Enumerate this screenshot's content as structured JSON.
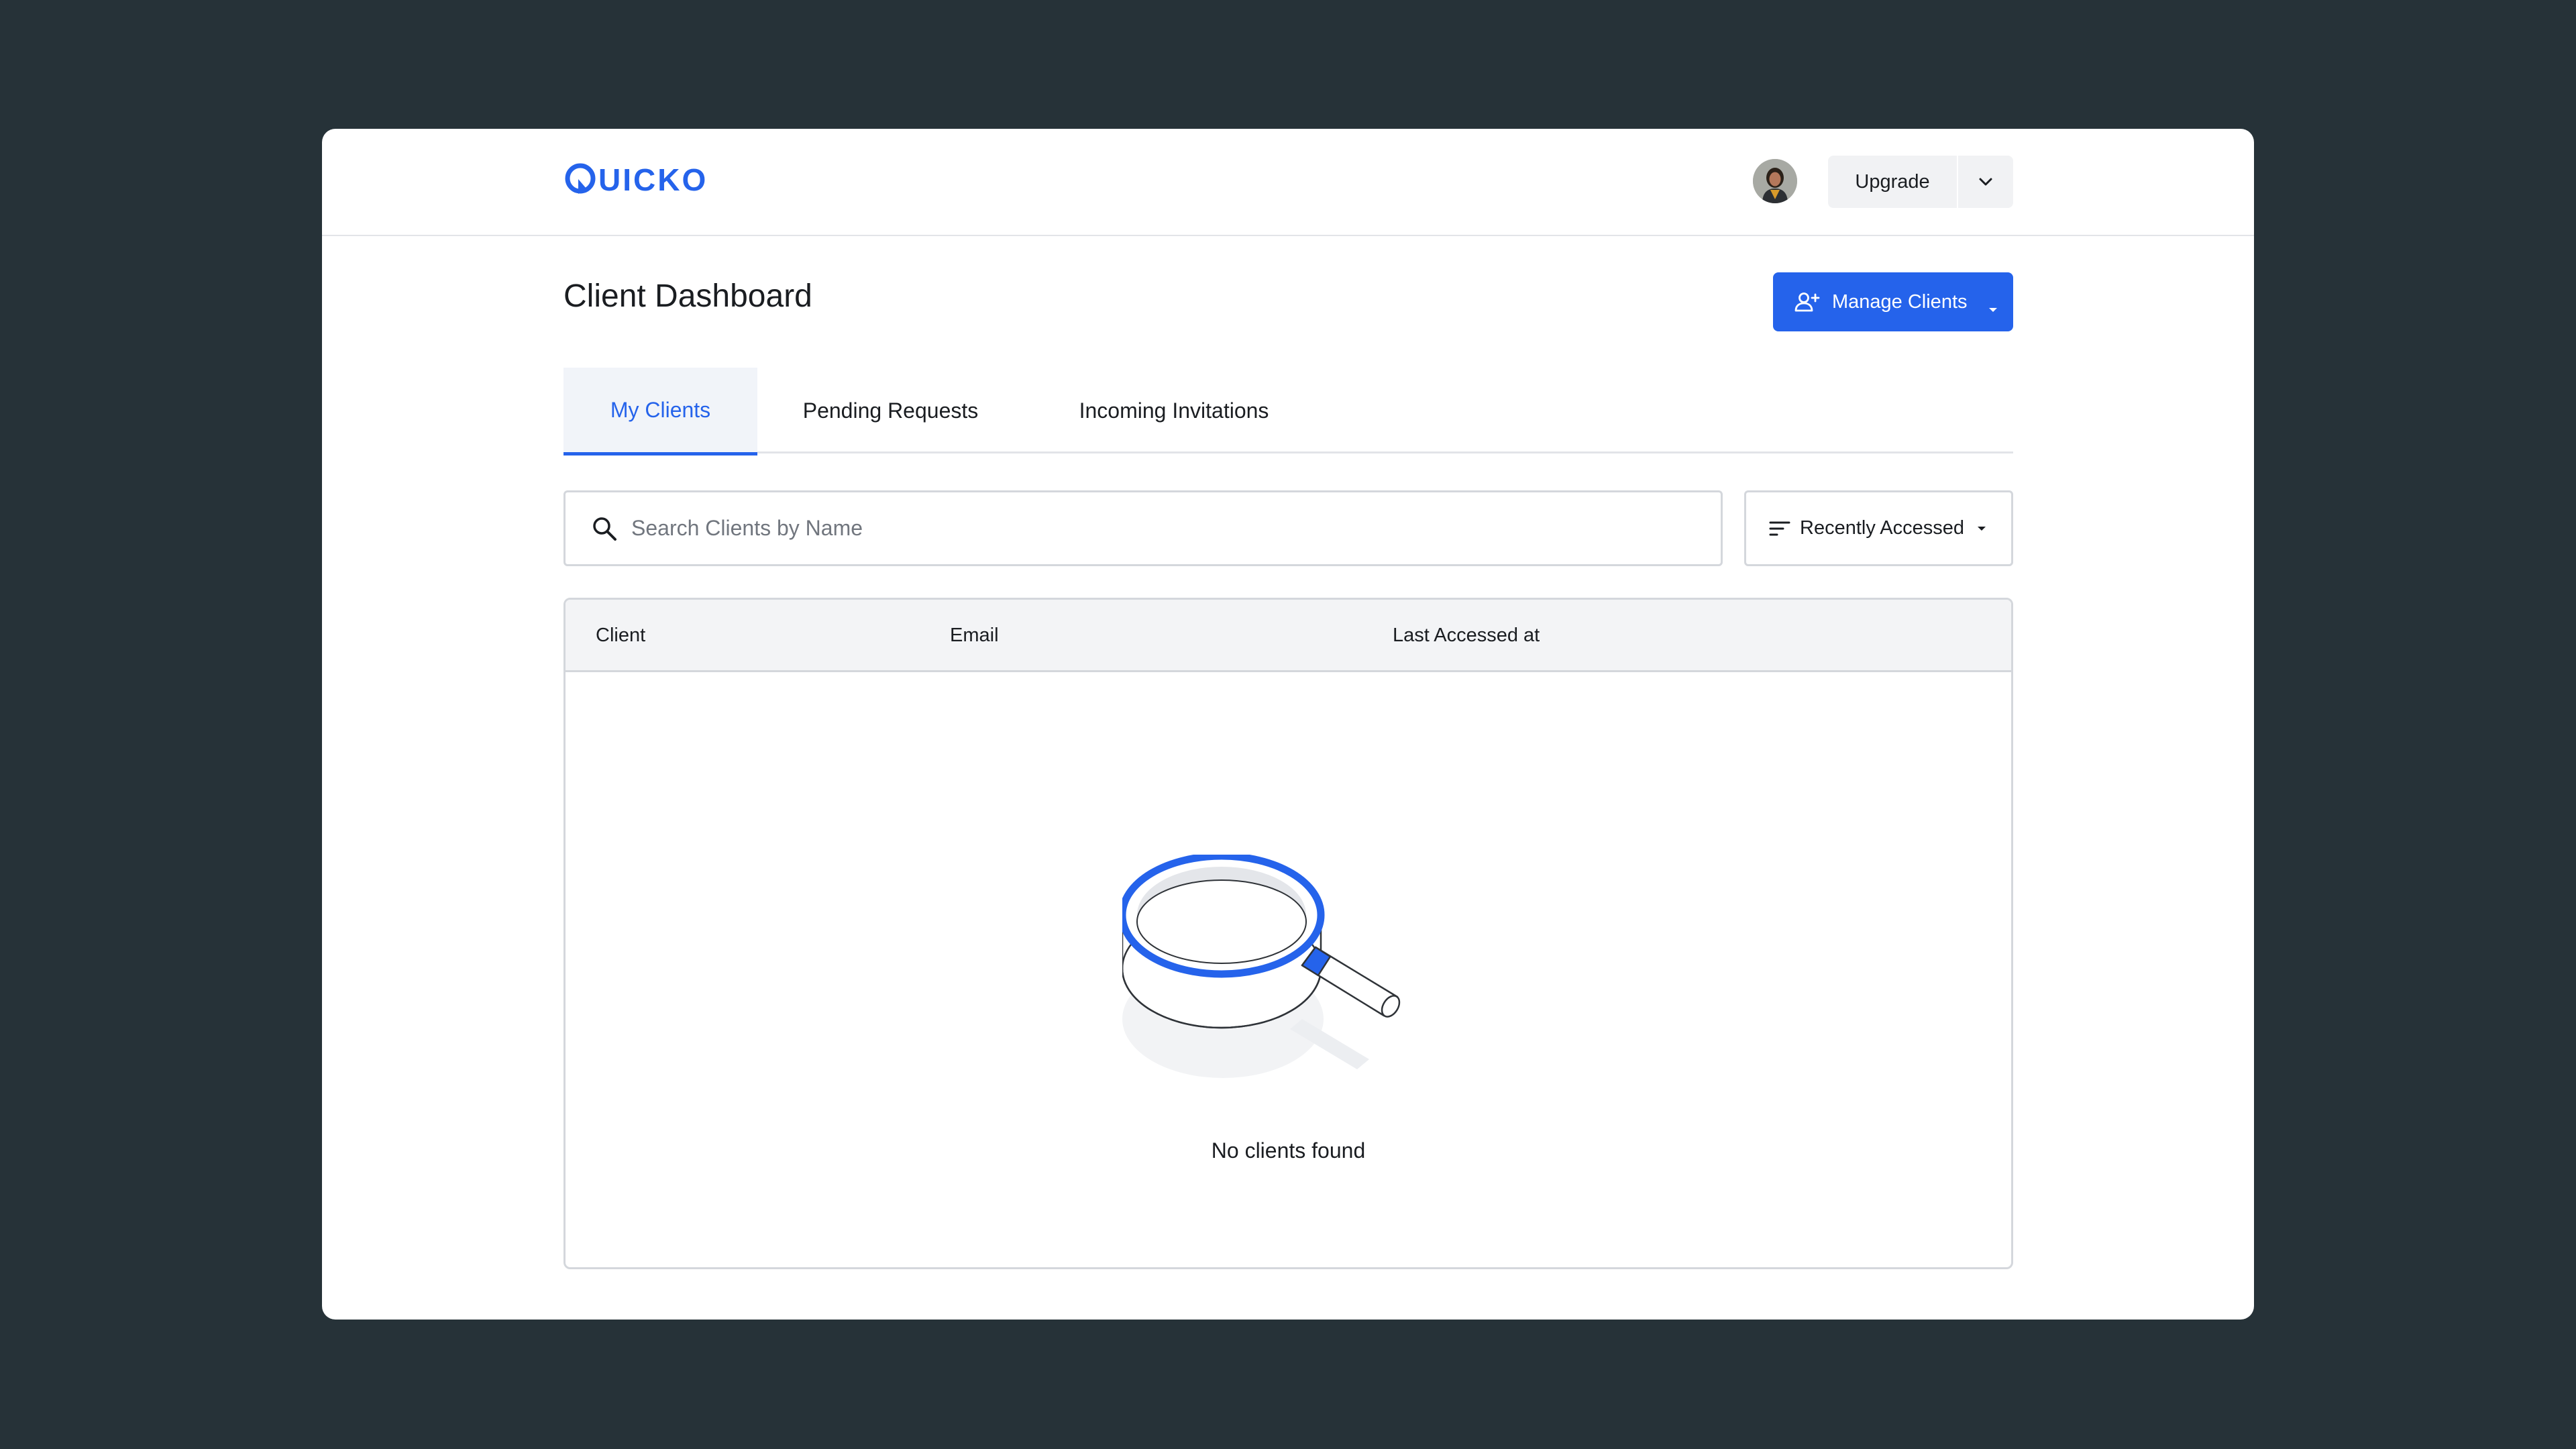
{
  "app": {
    "logo_text": "UICKO",
    "brand_color": "#2563eb"
  },
  "header": {
    "upgrade_label": "Upgrade"
  },
  "page": {
    "title": "Client Dashboard",
    "manage_clients_label": "Manage Clients"
  },
  "tabs": [
    {
      "label": "My Clients",
      "active": true
    },
    {
      "label": "Pending Requests",
      "active": false
    },
    {
      "label": "Incoming Invitations",
      "active": false
    }
  ],
  "search": {
    "placeholder": "Search Clients by Name",
    "value": ""
  },
  "sort": {
    "label": "Recently Accessed"
  },
  "table": {
    "columns": [
      "Client",
      "Email",
      "Last Accessed at"
    ],
    "rows": [],
    "empty_message": "No clients found"
  },
  "icons": {
    "logo": "quicko-q-icon",
    "avatar": "user-avatar",
    "upgrade_caret": "chevron-down-icon",
    "manage": "add-user-icon",
    "manage_caret": "caret-down-icon",
    "search": "search-icon",
    "sort": "sort-lines-icon",
    "sort_caret": "caret-down-icon",
    "empty": "magnifying-glass-illustration",
    "cursor": "mouse-pointer-icon"
  }
}
